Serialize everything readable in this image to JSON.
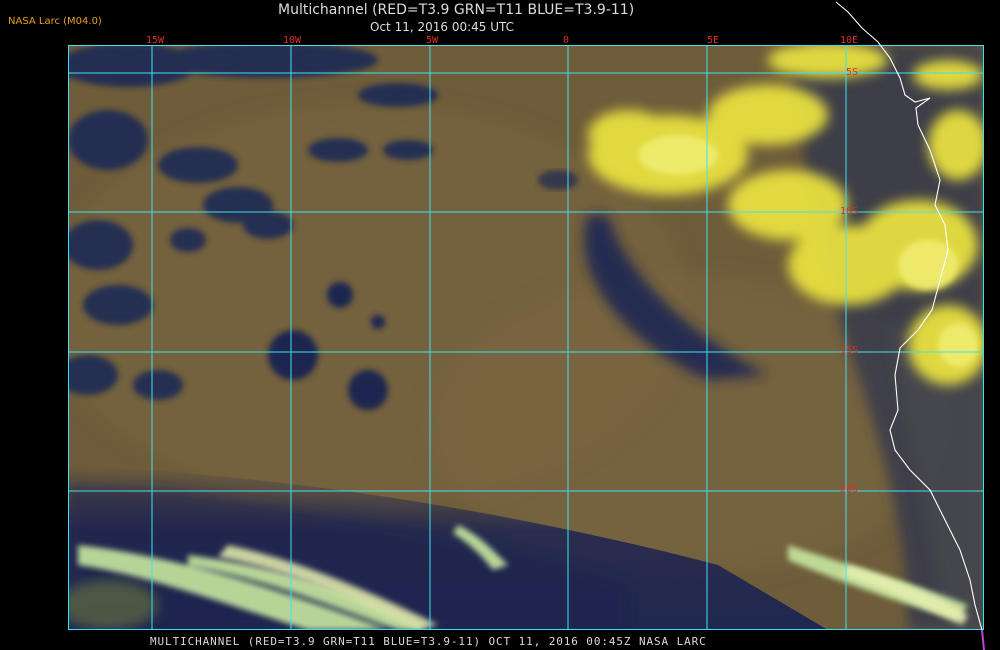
{
  "header": {
    "tag": "NASA Larc (M04.0)",
    "title": "Multichannel (RED=T3.9 GRN=T11 BLUE=T3.9-11)",
    "subtitle": "Oct 11, 2016 00:45 UTC"
  },
  "longitude_labels": [
    "15W",
    "10W",
    "5W",
    "0",
    "5E",
    "10E"
  ],
  "latitude_labels": [
    "5S",
    "10S",
    "15S",
    "20S"
  ],
  "footer": "MULTICHANNEL (RED=T3.9 GRN=T11 BLUE=T3.9-11) OCT 11, 2016 00:45Z  NASA LARC",
  "colors": {
    "grid": "#40e0f0",
    "label": "#e03020",
    "ocean_low_cloud": "#6b5a38",
    "clear_ocean": "#1c2450",
    "high_cloud": "#e8e040",
    "coastline": "#ffffff"
  }
}
